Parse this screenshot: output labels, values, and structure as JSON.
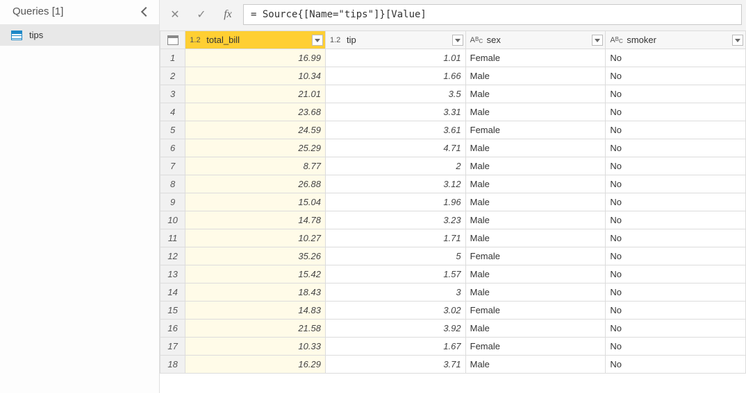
{
  "queries": {
    "header": "Queries [1]",
    "items": [
      {
        "name": "tips"
      }
    ]
  },
  "formula_bar": {
    "cancel_glyph": "✕",
    "confirm_glyph": "✓",
    "fx_label": "fx",
    "formula": "= Source{[Name=\"tips\"]}[Value]"
  },
  "grid": {
    "type_num": "1.2",
    "type_txt_prefix": "A",
    "type_txt_sup": "B",
    "type_txt_sub": "C",
    "columns": [
      {
        "key": "total_bill",
        "label": "total_bill",
        "type": "num",
        "selected": true
      },
      {
        "key": "tip",
        "label": "tip",
        "type": "num",
        "selected": false
      },
      {
        "key": "sex",
        "label": "sex",
        "type": "txt",
        "selected": false
      },
      {
        "key": "smoker",
        "label": "smoker",
        "type": "txt",
        "selected": false
      }
    ],
    "rows": [
      {
        "n": 1,
        "total_bill": "16.99",
        "tip": "1.01",
        "sex": "Female",
        "smoker": "No"
      },
      {
        "n": 2,
        "total_bill": "10.34",
        "tip": "1.66",
        "sex": "Male",
        "smoker": "No"
      },
      {
        "n": 3,
        "total_bill": "21.01",
        "tip": "3.5",
        "sex": "Male",
        "smoker": "No"
      },
      {
        "n": 4,
        "total_bill": "23.68",
        "tip": "3.31",
        "sex": "Male",
        "smoker": "No"
      },
      {
        "n": 5,
        "total_bill": "24.59",
        "tip": "3.61",
        "sex": "Female",
        "smoker": "No"
      },
      {
        "n": 6,
        "total_bill": "25.29",
        "tip": "4.71",
        "sex": "Male",
        "smoker": "No"
      },
      {
        "n": 7,
        "total_bill": "8.77",
        "tip": "2",
        "sex": "Male",
        "smoker": "No"
      },
      {
        "n": 8,
        "total_bill": "26.88",
        "tip": "3.12",
        "sex": "Male",
        "smoker": "No"
      },
      {
        "n": 9,
        "total_bill": "15.04",
        "tip": "1.96",
        "sex": "Male",
        "smoker": "No"
      },
      {
        "n": 10,
        "total_bill": "14.78",
        "tip": "3.23",
        "sex": "Male",
        "smoker": "No"
      },
      {
        "n": 11,
        "total_bill": "10.27",
        "tip": "1.71",
        "sex": "Male",
        "smoker": "No"
      },
      {
        "n": 12,
        "total_bill": "35.26",
        "tip": "5",
        "sex": "Female",
        "smoker": "No"
      },
      {
        "n": 13,
        "total_bill": "15.42",
        "tip": "1.57",
        "sex": "Male",
        "smoker": "No"
      },
      {
        "n": 14,
        "total_bill": "18.43",
        "tip": "3",
        "sex": "Male",
        "smoker": "No"
      },
      {
        "n": 15,
        "total_bill": "14.83",
        "tip": "3.02",
        "sex": "Female",
        "smoker": "No"
      },
      {
        "n": 16,
        "total_bill": "21.58",
        "tip": "3.92",
        "sex": "Male",
        "smoker": "No"
      },
      {
        "n": 17,
        "total_bill": "10.33",
        "tip": "1.67",
        "sex": "Female",
        "smoker": "No"
      },
      {
        "n": 18,
        "total_bill": "16.29",
        "tip": "3.71",
        "sex": "Male",
        "smoker": "No"
      }
    ]
  }
}
